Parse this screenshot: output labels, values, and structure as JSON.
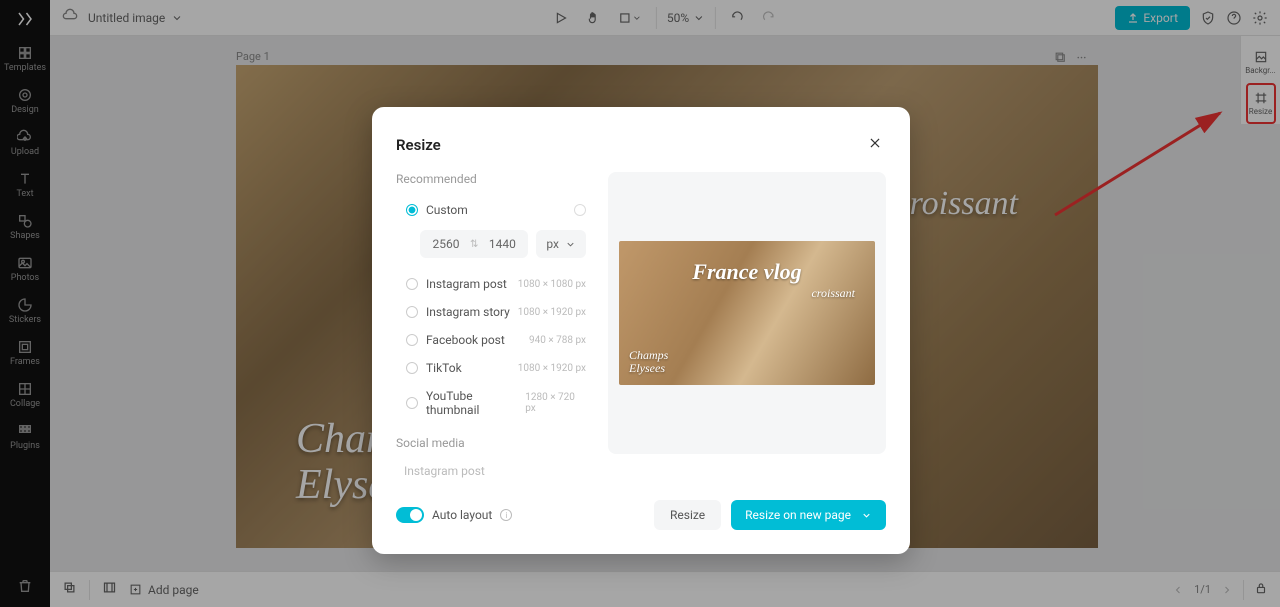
{
  "document": {
    "title": "Untitled image"
  },
  "sidebar": {
    "items": [
      {
        "label": "Templates"
      },
      {
        "label": "Design"
      },
      {
        "label": "Upload"
      },
      {
        "label": "Text"
      },
      {
        "label": "Shapes"
      },
      {
        "label": "Photos"
      },
      {
        "label": "Stickers"
      },
      {
        "label": "Frames"
      },
      {
        "label": "Collage"
      },
      {
        "label": "Plugins"
      }
    ]
  },
  "topbar": {
    "zoom": "50%",
    "export_label": "Export"
  },
  "right_panel": {
    "items": [
      {
        "label": "Backgr..."
      },
      {
        "label": "Resize"
      }
    ]
  },
  "canvas": {
    "page_label": "Page 1",
    "text_main": "France vlog",
    "text_croissant": "croissant",
    "text_champs": "Champs\nElysees"
  },
  "preview": {
    "text_main": "France vlog",
    "text_croissant": "croissant",
    "text_champs": "Champs\nElysees"
  },
  "bottombar": {
    "add_page_label": "Add page",
    "page_indicator": "1/1"
  },
  "modal": {
    "title": "Resize",
    "recommended_label": "Recommended",
    "custom_label": "Custom",
    "width_value": "2560",
    "height_value": "1440",
    "unit": "px",
    "presets": [
      {
        "label": "Instagram post",
        "dims": "1080 × 1080 px"
      },
      {
        "label": "Instagram story",
        "dims": "1080 × 1920 px"
      },
      {
        "label": "Facebook post",
        "dims": "940 × 788 px"
      },
      {
        "label": "TikTok",
        "dims": "1080 × 1920 px"
      },
      {
        "label": "YouTube thumbnail",
        "dims": "1280 × 720 px"
      }
    ],
    "social_label": "Social media",
    "social_items": [
      "Instagram post"
    ],
    "auto_layout_label": "Auto layout",
    "resize_button": "Resize",
    "resize_new_page_button": "Resize on new page"
  },
  "colors": {
    "accent": "#01bdd6",
    "highlight_border": "#e33"
  }
}
